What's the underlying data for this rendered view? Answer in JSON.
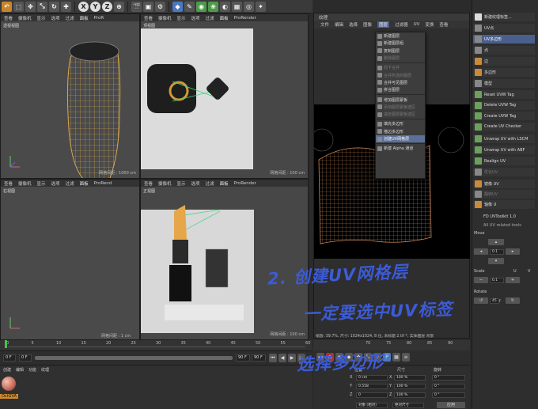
{
  "toolbar": {
    "axis_x": "X",
    "axis_y": "Y",
    "axis_z": "Z"
  },
  "viewports": {
    "menu_items": [
      "查看",
      "摄像机",
      "显示",
      "选项",
      "过滤",
      "面板"
    ],
    "renderer": "ProR",
    "renderer_full": "ProRender",
    "renderer_mid": "ProRend",
    "perspective": "透视视图",
    "top": "顶视图",
    "right": "右视图",
    "front": "正视图",
    "grid_1000": "网格间距 : 1000 cm",
    "grid_100a": "网格间距 : 100 cm",
    "grid_100b": "网格间距 : 100 cm",
    "grid_1": "网格间距 : 1 cm"
  },
  "texture": {
    "tab": "纹理",
    "menu": [
      "文件",
      "编辑",
      "选择",
      "图像",
      "图层",
      "过滤器",
      "UV",
      "变换",
      "查看"
    ],
    "active_menu": "图层",
    "status": "缩放: 39.7%, 尺寸: 1024x1024, 8 位, 未标题 2.tif *, 实体图层 背景"
  },
  "dropdown": {
    "items": [
      {
        "label": "新建图层",
        "state": "normal",
        "icon": "new-layer-icon"
      },
      {
        "label": "新建图层组",
        "state": "normal",
        "icon": "new-layer-group-icon"
      },
      {
        "label": "复制图层",
        "state": "normal",
        "icon": "copy-layer-icon"
      },
      {
        "label": "删除图层",
        "state": "dim",
        "icon": "delete-layer-icon"
      },
      {
        "label": "向下合并",
        "state": "dim",
        "icon": "merge-down-icon"
      },
      {
        "label": "合并所选的图层",
        "state": "dim",
        "icon": "merge-selected-icon"
      },
      {
        "label": "合并可见图层",
        "state": "normal",
        "icon": "merge-visible-icon"
      },
      {
        "label": "拼合图层",
        "state": "normal",
        "icon": "flatten-icon"
      },
      {
        "label": "增加图层蒙板",
        "state": "normal",
        "icon": "add-mask-icon"
      },
      {
        "label": "添加图层蒙板选区",
        "state": "dim",
        "icon": "mask-selection-icon"
      },
      {
        "label": "减去图层蒙板选区",
        "state": "dim",
        "icon": "mask-subtract-icon"
      },
      {
        "label": "填充多边形",
        "state": "normal",
        "icon": "fill-polygon-icon"
      },
      {
        "label": "描边多边形",
        "state": "normal",
        "icon": "stroke-polygon-icon"
      },
      {
        "label": "创建UV网格层",
        "state": "highlight",
        "icon": "uv-mesh-layer-icon"
      },
      {
        "label": "新建 Alpha 通道",
        "state": "normal",
        "icon": "alpha-channel-icon"
      }
    ]
  },
  "right_panel": {
    "top_items": [
      {
        "label": "新建纹理标签...",
        "style": "white"
      },
      {
        "label": "UV点",
        "style": "grey"
      },
      {
        "label": "UV多边形",
        "style": "grey",
        "selected": true
      },
      {
        "label": "点",
        "style": "grey"
      },
      {
        "label": "边",
        "style": "orange"
      },
      {
        "label": "多边形",
        "style": "orange"
      },
      {
        "label": "模型",
        "style": "grey"
      }
    ],
    "tag_items": [
      "Reset UVW Tag",
      "Delete UVW Tag",
      "Create UVW Tag",
      "Create UV Checker"
    ],
    "unwrap_items": [
      "Unwrap UV with LSCM",
      "Unwrap UV with ABF",
      "Realign UV",
      "优化UV"
    ],
    "transform_items": [
      "镜像 UV",
      "翻转UV",
      "轴像 U"
    ],
    "toolkit_title": "FD UVToolkit 1.0",
    "toolkit_sub": "All UV related tools",
    "move_label": "Move",
    "scale_label": "Scale",
    "rotate_label": "Rotate",
    "move_value": "0.1",
    "scale_value": "0.1",
    "rotate_value": "45",
    "u_label": "U",
    "v_label": "V",
    "f_label": "f",
    "deg_suffix": "°"
  },
  "timeline": {
    "ticks": [
      "0",
      "5",
      "10",
      "15",
      "20",
      "25",
      "30",
      "35",
      "40",
      "45",
      "50",
      "55",
      "60"
    ],
    "tex_ticks": [
      "70",
      "75",
      "80",
      "85",
      "90"
    ],
    "start_frame": "0 F",
    "end_frame": "90 F",
    "end_frame2": "90 F",
    "current_frame": "0 F"
  },
  "materials": {
    "menu": [
      "创建",
      "编辑",
      "功能",
      "纹理"
    ],
    "material_name": "OctGVA"
  },
  "coords": {
    "headers": [
      "位置",
      "尺寸",
      "旋转"
    ],
    "rows": [
      {
        "axis": "X",
        "pos": "0 cm",
        "size": "100 %",
        "rot": "0 °"
      },
      {
        "axis": "Y",
        "pos": "0.558",
        "size": "100 %",
        "rot": "0 °"
      },
      {
        "axis": "Z",
        "pos": "0",
        "size": "100 %",
        "rot": "0 °"
      }
    ],
    "mode": "对象 (相对)",
    "size_mode": "绝对尺寸",
    "apply": "应用"
  },
  "annotation": {
    "line1": "2. 创建UV网格层",
    "line2": "一定要选中UV标签",
    "line3": "选择多边形",
    "color": "#3c5bd6"
  }
}
